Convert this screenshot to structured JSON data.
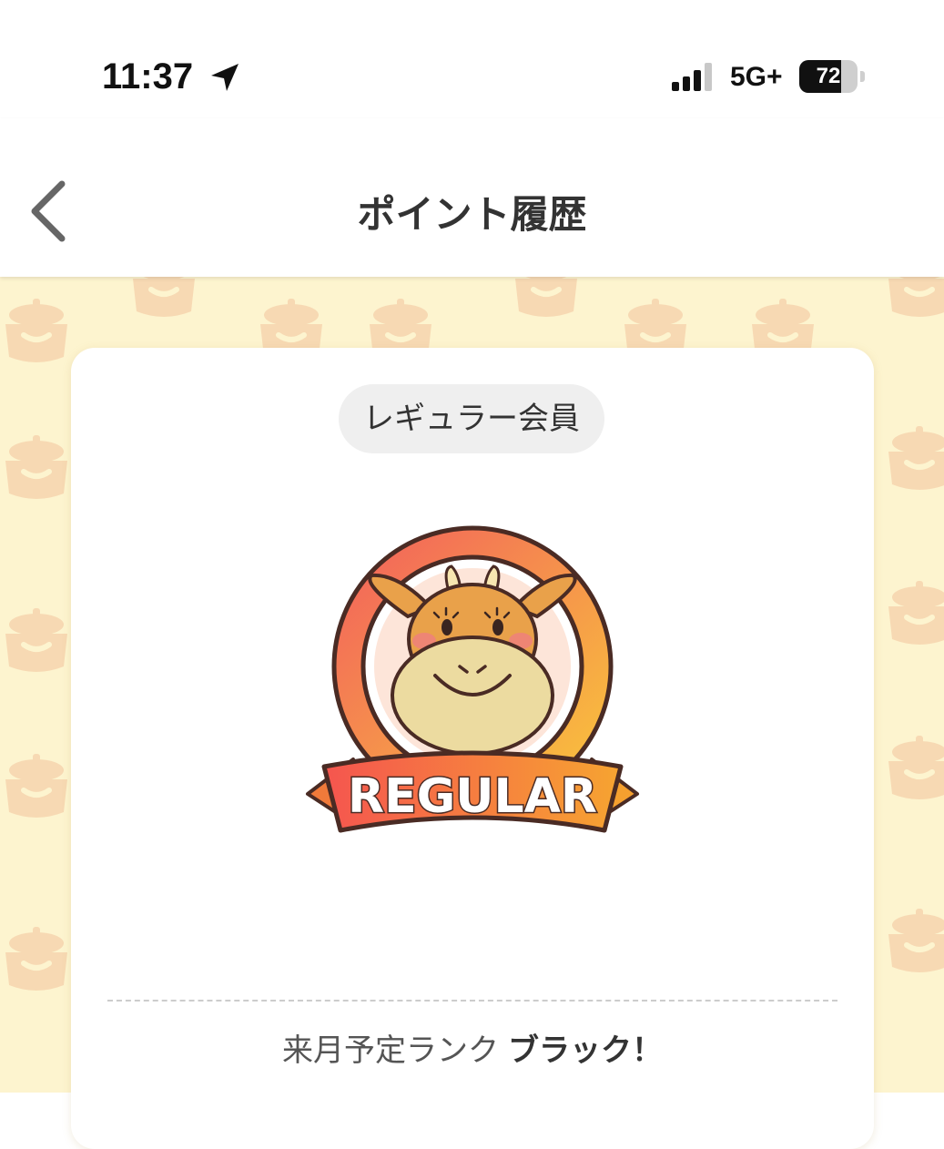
{
  "status_bar": {
    "time": "11:37",
    "network": "5G+",
    "battery": "72",
    "battery_level": 0.72
  },
  "nav": {
    "title": "ポイント履歴"
  },
  "card": {
    "rank_label": "レギュラー会員",
    "badge_text": "REGULAR",
    "next_rank_label": "来月予定ランク",
    "next_rank_value": "ブラック！"
  },
  "colors": {
    "background_pattern": "#fdf4cf",
    "pattern_icon": "#f7ddb8",
    "badge_gradient_start": "#f46a5a",
    "badge_gradient_end": "#f8c23a"
  }
}
